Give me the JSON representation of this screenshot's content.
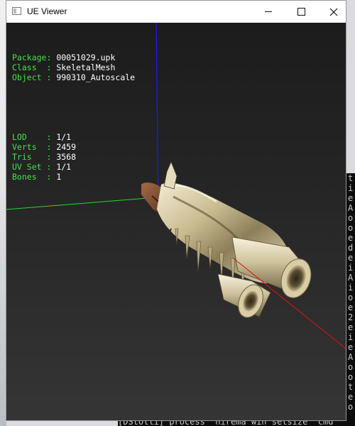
{
  "window": {
    "title": "UE Viewer"
  },
  "titlebar_icons": [
    "app-icon",
    "minimize-icon",
    "maximize-icon",
    "close-icon"
  ],
  "info": {
    "group1": [
      {
        "key": "Package:",
        "value": "00051029.upk"
      },
      {
        "key": "Class  :",
        "value": "SkeletalMesh"
      },
      {
        "key": "Object :",
        "value": "990310_Autoscale"
      }
    ],
    "group2": [
      {
        "key": "LOD    :",
        "value": "1/1"
      },
      {
        "key": "Verts  :",
        "value": "2459"
      },
      {
        "key": "Tris   :",
        "value": "3568"
      },
      {
        "key": "UV Set :",
        "value": "1/1"
      },
      {
        "key": "Bones  :",
        "value": "1"
      }
    ]
  },
  "console_right_chars": [
    "t",
    "i",
    "e",
    "A",
    "o",
    "o",
    "e",
    "d",
    "e",
    "i",
    "A",
    "i",
    "o",
    "e",
    "2",
    "e",
    "i",
    "e",
    "A",
    "o",
    "o",
    "t",
    "e",
    "o"
  ],
  "console_bottom_text": "[DStolli] process 'hirema win setsize' cmd",
  "colors": {
    "info_key": "#44e044",
    "info_value": "#ffffff",
    "axis_x": "#22dd22",
    "axis_y": "#1a1aff",
    "axis_z": "#dd1111"
  }
}
